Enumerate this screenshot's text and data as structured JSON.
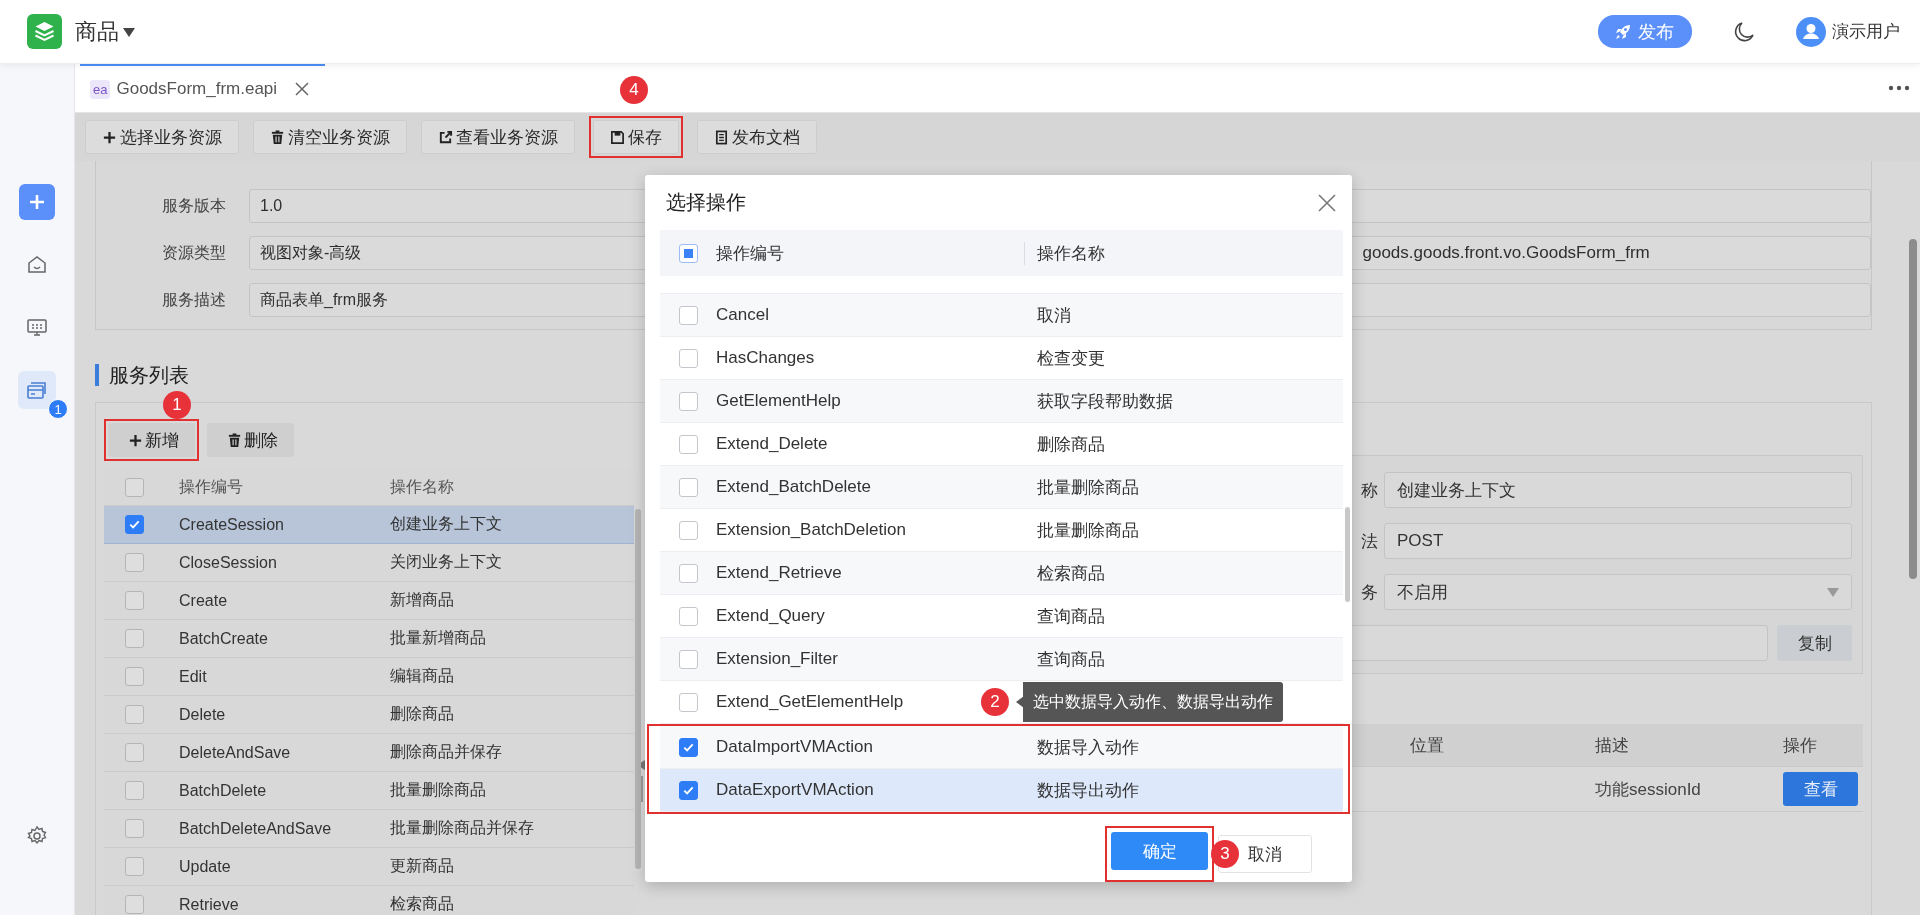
{
  "header": {
    "app_title": "商品",
    "publish_button": "发布",
    "user_name": "演示用户"
  },
  "sidebar": {
    "items": [
      {
        "kind": "add",
        "selected": false
      },
      {
        "kind": "home",
        "selected": false
      },
      {
        "kind": "monitor",
        "selected": false
      },
      {
        "kind": "services",
        "selected": true,
        "badge": "1"
      }
    ],
    "footer_items": [
      {
        "kind": "settings",
        "selected": false
      }
    ]
  },
  "tabs": [
    {
      "label": "GoodsForm_frm.eapi",
      "file_type": "ea",
      "selected": true
    }
  ],
  "toolbar": [
    {
      "label": "选择业务资源",
      "kind": "add",
      "highlighted": false
    },
    {
      "label": "清空业务资源",
      "kind": "clear",
      "highlighted": false
    },
    {
      "label": "查看业务资源",
      "kind": "view",
      "highlighted": false
    },
    {
      "label": "保存",
      "kind": "save",
      "highlighted": true,
      "step": "4"
    },
    {
      "label": "发布文档",
      "kind": "publish",
      "highlighted": false
    }
  ],
  "service_info": {
    "fields": [
      {
        "label": "服务版本",
        "value": "1.0"
      },
      {
        "label": "资源类型",
        "value": "视图对象-高级"
      },
      {
        "label": "服务描述",
        "value": "商品表单_frm服务"
      }
    ],
    "right_fields": [
      {
        "kind": "empty"
      },
      {
        "kind": "text",
        "value": "goods.goods.front.vo.GoodsForm_frm"
      },
      {
        "kind": "empty"
      }
    ]
  },
  "services": {
    "title": "服务列表",
    "actions": [
      {
        "label": "新增",
        "kind": "add",
        "highlighted": true,
        "step": "1"
      },
      {
        "label": "删除",
        "kind": "delete",
        "highlighted": false
      }
    ],
    "columns": [
      "操作编号",
      "操作名称"
    ],
    "header_checked": false,
    "rows": [
      {
        "code": "CreateSession",
        "name": "创建业务上下文",
        "checked": true,
        "selected": true
      },
      {
        "code": "CloseSession",
        "name": "关闭业务上下文",
        "checked": false,
        "selected": false
      },
      {
        "code": "Create",
        "name": "新增商品",
        "checked": false,
        "selected": false
      },
      {
        "code": "BatchCreate",
        "name": "批量新增商品",
        "checked": false,
        "selected": false
      },
      {
        "code": "Edit",
        "name": "编辑商品",
        "checked": false,
        "selected": false
      },
      {
        "code": "Delete",
        "name": "删除商品",
        "checked": false,
        "selected": false
      },
      {
        "code": "DeleteAndSave",
        "name": "删除商品并保存",
        "checked": false,
        "selected": false
      },
      {
        "code": "BatchDelete",
        "name": "批量删除商品",
        "checked": false,
        "selected": false
      },
      {
        "code": "BatchDeleteAndSave",
        "name": "批量删除商品并保存",
        "checked": false,
        "selected": false
      },
      {
        "code": "Update",
        "name": "更新商品",
        "checked": false,
        "selected": false
      },
      {
        "code": "Retrieve",
        "name": "检索商品",
        "checked": false,
        "selected": false
      }
    ]
  },
  "detail": {
    "fields": [
      {
        "kind": "input",
        "label": "称",
        "value": "创建业务上下文"
      },
      {
        "kind": "input",
        "label": "法",
        "value": "POST"
      },
      {
        "kind": "select",
        "label": "务",
        "value": "不启用"
      },
      {
        "kind": "copy",
        "button": "复制"
      }
    ],
    "table": {
      "columns": [
        "位置",
        "描述",
        "操作"
      ],
      "rows": [
        {
          "description": "功能sessionId",
          "action": "查看"
        }
      ]
    }
  },
  "dialog": {
    "title": "选择操作",
    "columns": [
      "操作编号",
      "操作名称"
    ],
    "header_indeterminate": true,
    "rows": [
      {
        "code": "Cancel",
        "name": "取消",
        "checked": false,
        "highlighted": false
      },
      {
        "code": "HasChanges",
        "name": "检查变更",
        "checked": false,
        "highlighted": false
      },
      {
        "code": "GetElementHelp",
        "name": "获取字段帮助数据",
        "checked": false,
        "highlighted": false
      },
      {
        "code": "Extend_Delete",
        "name": "删除商品",
        "checked": false,
        "highlighted": false
      },
      {
        "code": "Extend_BatchDelete",
        "name": "批量删除商品",
        "checked": false,
        "highlighted": false
      },
      {
        "code": "Extension_BatchDeletion",
        "name": "批量删除商品",
        "checked": false,
        "highlighted": false
      },
      {
        "code": "Extend_Retrieve",
        "name": "检索商品",
        "checked": false,
        "highlighted": false
      },
      {
        "code": "Extend_Query",
        "name": "查询商品",
        "checked": false,
        "highlighted": false
      },
      {
        "code": "Extension_Filter",
        "name": "查询商品",
        "checked": false,
        "highlighted": false
      },
      {
        "code": "Extend_GetElementHelp",
        "checked": false,
        "highlighted": false,
        "tooltip": {
          "text": "选中数据导入动作、数据导出动作",
          "step": "2"
        }
      },
      {
        "code": "DataImportVMAction",
        "name": "数据导入动作",
        "checked": true,
        "highlighted": true
      },
      {
        "code": "DataExportVMAction",
        "name": "数据导出动作",
        "checked": true,
        "highlighted": true
      }
    ],
    "buttons": [
      {
        "label": "确定",
        "kind": "primary",
        "highlighted": true,
        "step": "3"
      },
      {
        "label": "取消",
        "kind": "default",
        "highlighted": false
      }
    ]
  }
}
